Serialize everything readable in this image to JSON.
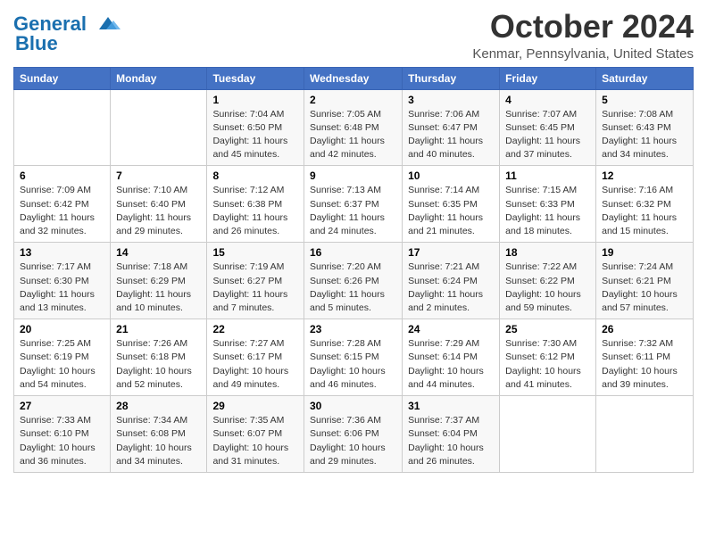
{
  "header": {
    "logo_general": "General",
    "logo_blue": "Blue",
    "month_title": "October 2024",
    "location": "Kenmar, Pennsylvania, United States"
  },
  "days_of_week": [
    "Sunday",
    "Monday",
    "Tuesday",
    "Wednesday",
    "Thursday",
    "Friday",
    "Saturday"
  ],
  "weeks": [
    [
      {
        "day": "",
        "info": ""
      },
      {
        "day": "",
        "info": ""
      },
      {
        "day": "1",
        "info": "Sunrise: 7:04 AM\nSunset: 6:50 PM\nDaylight: 11 hours and 45 minutes."
      },
      {
        "day": "2",
        "info": "Sunrise: 7:05 AM\nSunset: 6:48 PM\nDaylight: 11 hours and 42 minutes."
      },
      {
        "day": "3",
        "info": "Sunrise: 7:06 AM\nSunset: 6:47 PM\nDaylight: 11 hours and 40 minutes."
      },
      {
        "day": "4",
        "info": "Sunrise: 7:07 AM\nSunset: 6:45 PM\nDaylight: 11 hours and 37 minutes."
      },
      {
        "day": "5",
        "info": "Sunrise: 7:08 AM\nSunset: 6:43 PM\nDaylight: 11 hours and 34 minutes."
      }
    ],
    [
      {
        "day": "6",
        "info": "Sunrise: 7:09 AM\nSunset: 6:42 PM\nDaylight: 11 hours and 32 minutes."
      },
      {
        "day": "7",
        "info": "Sunrise: 7:10 AM\nSunset: 6:40 PM\nDaylight: 11 hours and 29 minutes."
      },
      {
        "day": "8",
        "info": "Sunrise: 7:12 AM\nSunset: 6:38 PM\nDaylight: 11 hours and 26 minutes."
      },
      {
        "day": "9",
        "info": "Sunrise: 7:13 AM\nSunset: 6:37 PM\nDaylight: 11 hours and 24 minutes."
      },
      {
        "day": "10",
        "info": "Sunrise: 7:14 AM\nSunset: 6:35 PM\nDaylight: 11 hours and 21 minutes."
      },
      {
        "day": "11",
        "info": "Sunrise: 7:15 AM\nSunset: 6:33 PM\nDaylight: 11 hours and 18 minutes."
      },
      {
        "day": "12",
        "info": "Sunrise: 7:16 AM\nSunset: 6:32 PM\nDaylight: 11 hours and 15 minutes."
      }
    ],
    [
      {
        "day": "13",
        "info": "Sunrise: 7:17 AM\nSunset: 6:30 PM\nDaylight: 11 hours and 13 minutes."
      },
      {
        "day": "14",
        "info": "Sunrise: 7:18 AM\nSunset: 6:29 PM\nDaylight: 11 hours and 10 minutes."
      },
      {
        "day": "15",
        "info": "Sunrise: 7:19 AM\nSunset: 6:27 PM\nDaylight: 11 hours and 7 minutes."
      },
      {
        "day": "16",
        "info": "Sunrise: 7:20 AM\nSunset: 6:26 PM\nDaylight: 11 hours and 5 minutes."
      },
      {
        "day": "17",
        "info": "Sunrise: 7:21 AM\nSunset: 6:24 PM\nDaylight: 11 hours and 2 minutes."
      },
      {
        "day": "18",
        "info": "Sunrise: 7:22 AM\nSunset: 6:22 PM\nDaylight: 10 hours and 59 minutes."
      },
      {
        "day": "19",
        "info": "Sunrise: 7:24 AM\nSunset: 6:21 PM\nDaylight: 10 hours and 57 minutes."
      }
    ],
    [
      {
        "day": "20",
        "info": "Sunrise: 7:25 AM\nSunset: 6:19 PM\nDaylight: 10 hours and 54 minutes."
      },
      {
        "day": "21",
        "info": "Sunrise: 7:26 AM\nSunset: 6:18 PM\nDaylight: 10 hours and 52 minutes."
      },
      {
        "day": "22",
        "info": "Sunrise: 7:27 AM\nSunset: 6:17 PM\nDaylight: 10 hours and 49 minutes."
      },
      {
        "day": "23",
        "info": "Sunrise: 7:28 AM\nSunset: 6:15 PM\nDaylight: 10 hours and 46 minutes."
      },
      {
        "day": "24",
        "info": "Sunrise: 7:29 AM\nSunset: 6:14 PM\nDaylight: 10 hours and 44 minutes."
      },
      {
        "day": "25",
        "info": "Sunrise: 7:30 AM\nSunset: 6:12 PM\nDaylight: 10 hours and 41 minutes."
      },
      {
        "day": "26",
        "info": "Sunrise: 7:32 AM\nSunset: 6:11 PM\nDaylight: 10 hours and 39 minutes."
      }
    ],
    [
      {
        "day": "27",
        "info": "Sunrise: 7:33 AM\nSunset: 6:10 PM\nDaylight: 10 hours and 36 minutes."
      },
      {
        "day": "28",
        "info": "Sunrise: 7:34 AM\nSunset: 6:08 PM\nDaylight: 10 hours and 34 minutes."
      },
      {
        "day": "29",
        "info": "Sunrise: 7:35 AM\nSunset: 6:07 PM\nDaylight: 10 hours and 31 minutes."
      },
      {
        "day": "30",
        "info": "Sunrise: 7:36 AM\nSunset: 6:06 PM\nDaylight: 10 hours and 29 minutes."
      },
      {
        "day": "31",
        "info": "Sunrise: 7:37 AM\nSunset: 6:04 PM\nDaylight: 10 hours and 26 minutes."
      },
      {
        "day": "",
        "info": ""
      },
      {
        "day": "",
        "info": ""
      }
    ]
  ]
}
